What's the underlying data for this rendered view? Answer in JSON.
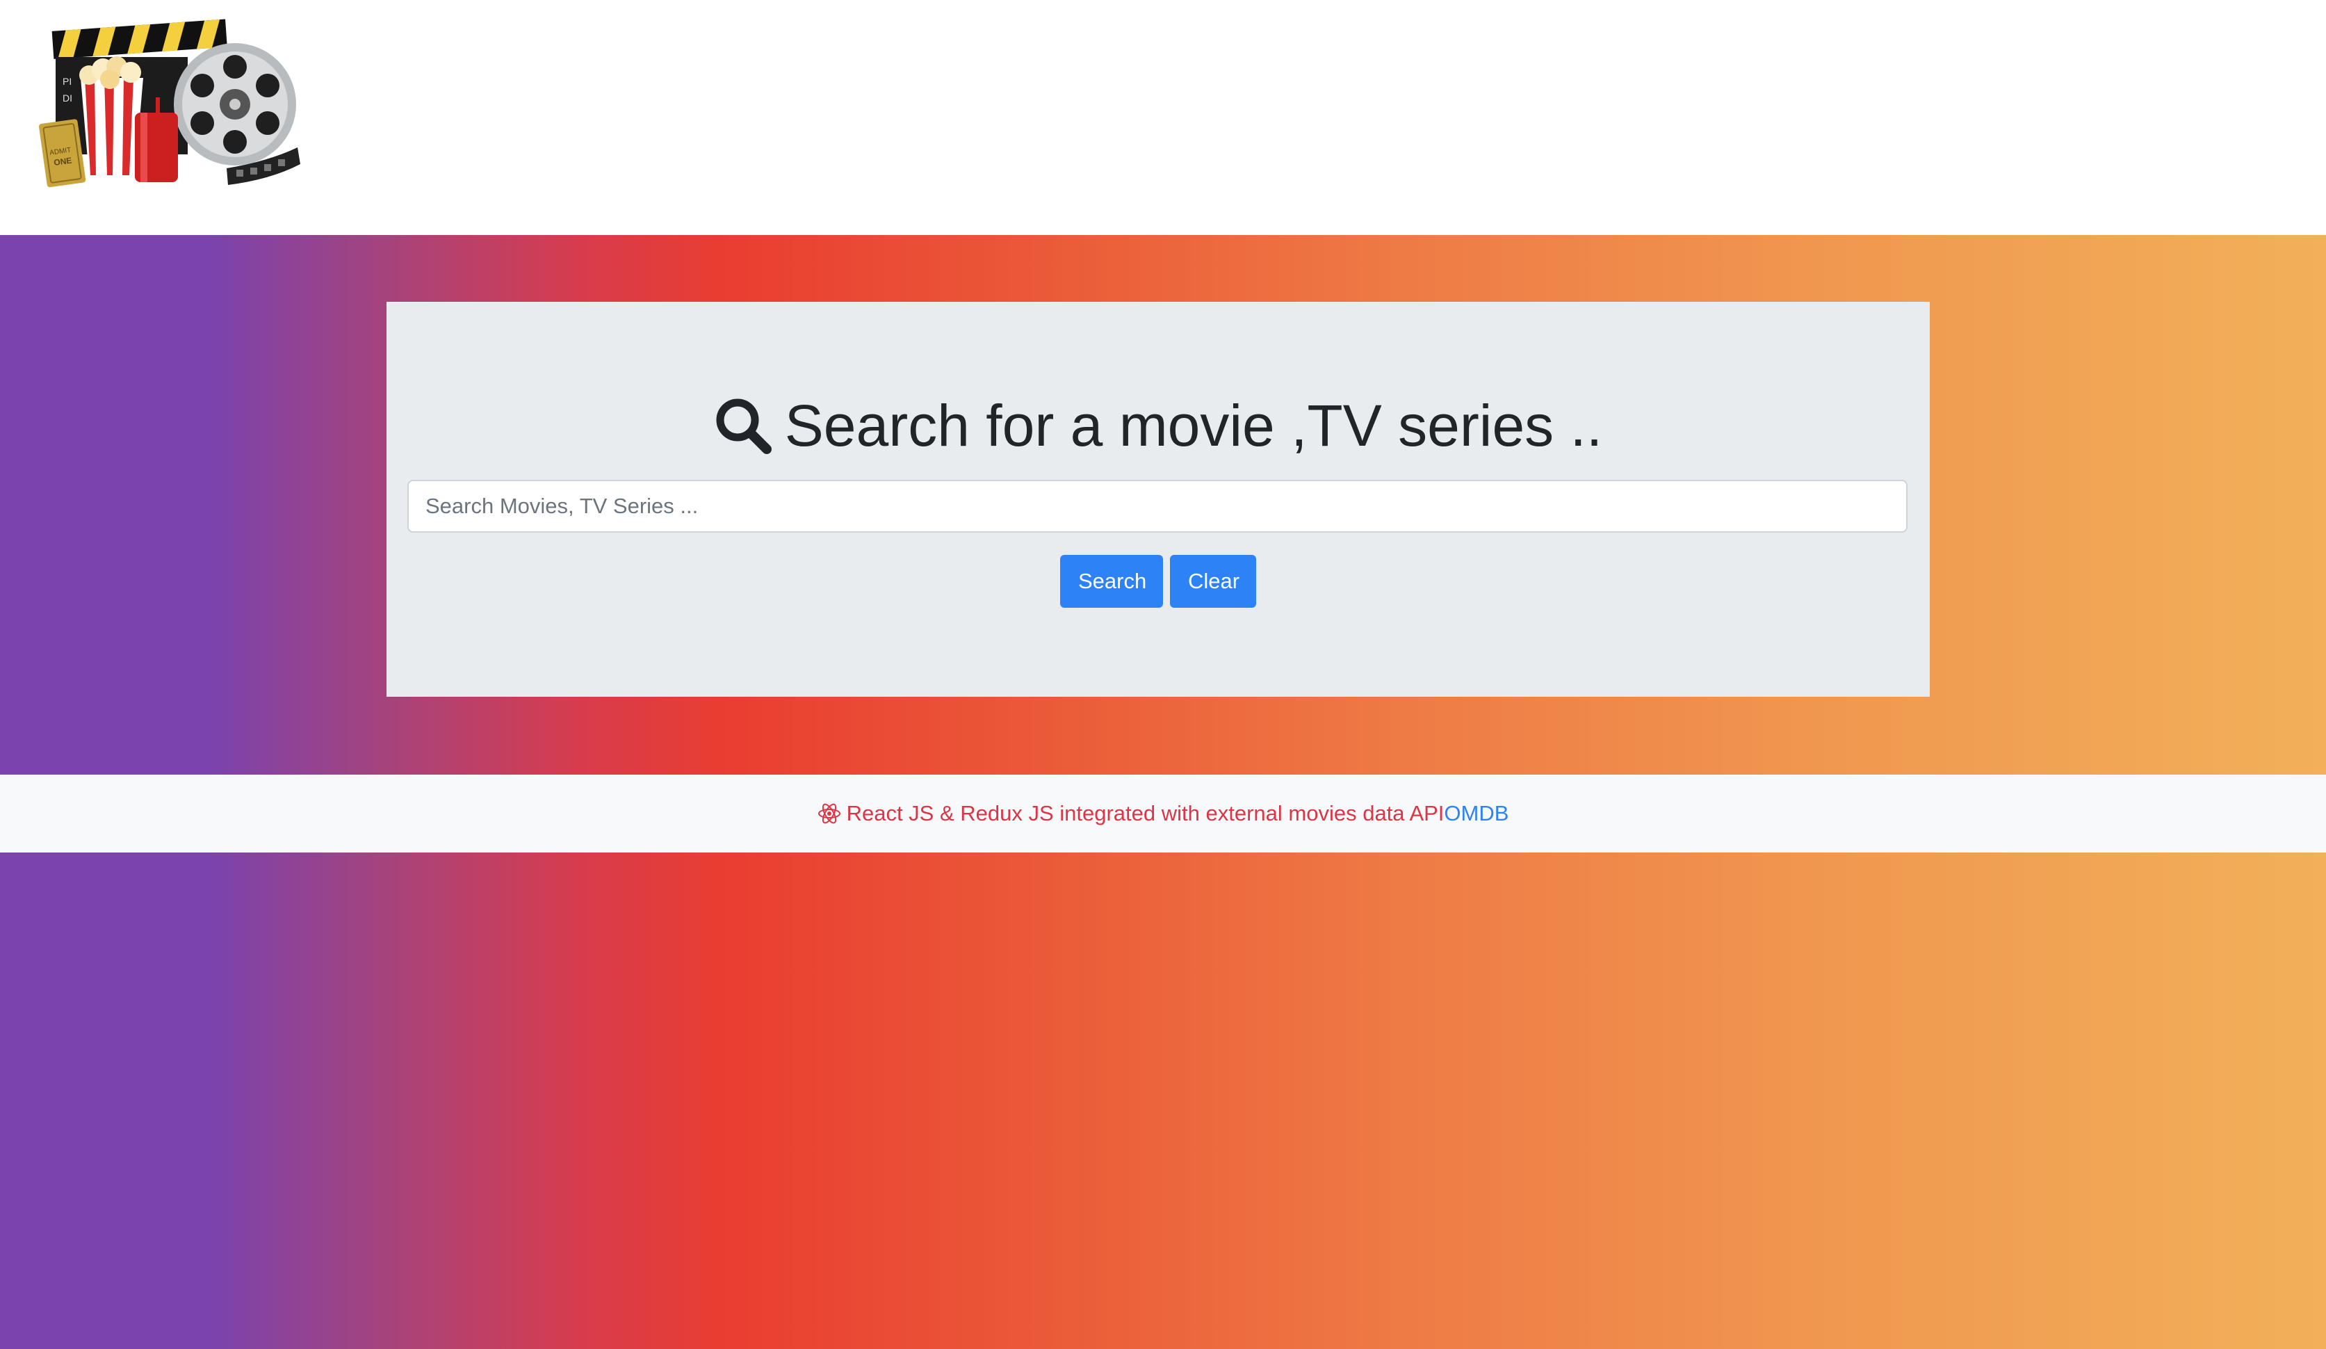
{
  "header": {
    "logo_text": "ADMIT ONE"
  },
  "search_panel": {
    "title": "Search for a movie ,TV series ..",
    "title_icon": "search-icon",
    "input_placeholder": "Search Movies, TV Series ...",
    "input_value": "",
    "search_button_label": "Search",
    "clear_button_label": "Clear"
  },
  "footer": {
    "icon": "react-icon",
    "text": "React JS & Redux JS integrated with external movies data API",
    "link_label": "OMDB"
  },
  "colors": {
    "primary": "#2d82f6",
    "footer_text": "#dc3545",
    "panel_background": "#e9ecef"
  }
}
